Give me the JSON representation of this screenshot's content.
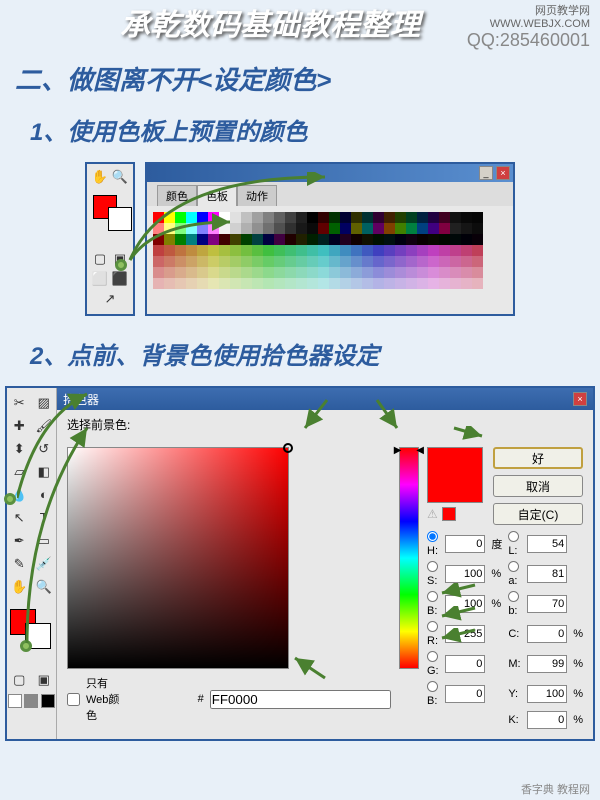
{
  "header": {
    "title_cn": "承乾数码基础教程整理",
    "site_cn": "网页教学网",
    "site_url": "WWW.WEBJX.COM",
    "qq": "QQ:285460001"
  },
  "headings": {
    "h2": "二、做图离不开<设定颜色>",
    "s1": "1、使用色板上预置的颜色",
    "s2": "2、点前、背景色使用拾色器设定"
  },
  "swatch_panel": {
    "tabs": [
      "颜色",
      "色板",
      "动作"
    ],
    "active_tab": 1
  },
  "picker": {
    "title": "拾色器",
    "label": "选择前景色:",
    "buttons": {
      "ok": "好",
      "cancel": "取消",
      "custom": "自定(C)"
    },
    "web_only": "只有Web颜色",
    "hex": "FF0000",
    "hsb": {
      "h_label": "H:",
      "s_label": "S:",
      "b_label": "B:",
      "h": "0",
      "s": "100",
      "b": "100",
      "h_unit": "度",
      "pct": "%"
    },
    "lab": {
      "l_label": "L:",
      "a_label": "a:",
      "b_label": "b:",
      "l": "54",
      "a": "81",
      "b": "70"
    },
    "rgb": {
      "r_label": "R:",
      "g_label": "G:",
      "b_label": "B:",
      "r": "255",
      "g": "0",
      "b": "0"
    },
    "cmyk": {
      "c_label": "C:",
      "m_label": "M:",
      "y_label": "Y:",
      "k_label": "K:",
      "c": "0",
      "m": "99",
      "y": "100",
      "k": "0",
      "pct": "%"
    }
  },
  "watermark": "香字典 教程网"
}
